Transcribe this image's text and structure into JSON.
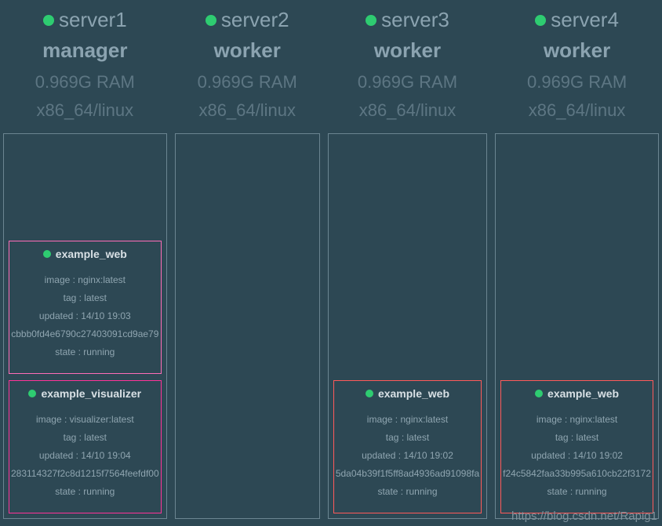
{
  "watermark": "https://blog.csdn.net/Rapig1",
  "nodes": [
    {
      "name": "server1",
      "role": "manager",
      "ram": "0.969G RAM",
      "arch": "x86_64/linux",
      "services": [
        {
          "color": "pink",
          "name": "example_web",
          "image": "image : nginx:latest",
          "tag": "tag : latest",
          "updated": "updated : 14/10 19:03",
          "id": "cbbb0fd4e6790c27403091cd9ae79",
          "state": "state : running"
        },
        {
          "color": "magenta",
          "name": "example_visualizer",
          "image": "image : visualizer:latest",
          "tag": "tag : latest",
          "updated": "updated : 14/10 19:04",
          "id": "283114327f2c8d1215f7564feefdf00",
          "state": "state : running"
        }
      ]
    },
    {
      "name": "server2",
      "role": "worker",
      "ram": "0.969G RAM",
      "arch": "x86_64/linux",
      "services": []
    },
    {
      "name": "server3",
      "role": "worker",
      "ram": "0.969G RAM",
      "arch": "x86_64/linux",
      "services": [
        {
          "color": "red",
          "name": "example_web",
          "image": "image : nginx:latest",
          "tag": "tag : latest",
          "updated": "updated : 14/10 19:02",
          "id": "5da04b39f1f5ff8ad4936ad91098fa",
          "state": "state : running"
        }
      ]
    },
    {
      "name": "server4",
      "role": "worker",
      "ram": "0.969G RAM",
      "arch": "x86_64/linux",
      "services": [
        {
          "color": "red",
          "name": "example_web",
          "image": "image : nginx:latest",
          "tag": "tag : latest",
          "updated": "updated : 14/10 19:02",
          "id": "f24c5842faa33b995a610cb22f3172",
          "state": "state : running"
        }
      ]
    }
  ]
}
